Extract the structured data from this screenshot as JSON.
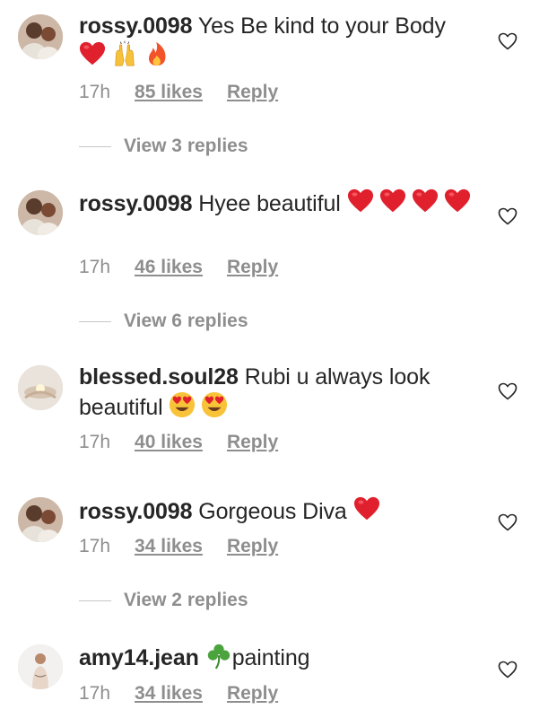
{
  "comments": [
    {
      "username": "rossy.0098",
      "text": "Yes Be kind to your Body",
      "time": "17h",
      "likes": "85 likes",
      "reply": "Reply",
      "view_replies": "View 3 replies"
    },
    {
      "username": "rossy.0098",
      "text": "Hyee beautiful",
      "time": "17h",
      "likes": "46 likes",
      "reply": "Reply",
      "view_replies": "View 6 replies"
    },
    {
      "username": "blessed.soul28",
      "text": "Rubi u always look beautiful",
      "time": "17h",
      "likes": "40 likes",
      "reply": "Reply"
    },
    {
      "username": "rossy.0098",
      "text": "Gorgeous Diva",
      "time": "17h",
      "likes": "34 likes",
      "reply": "Reply",
      "view_replies": "View 2 replies"
    },
    {
      "username": "amy14.jean",
      "text": "painting",
      "time": "17h",
      "likes": "34 likes",
      "reply": "Reply"
    }
  ],
  "colors": {
    "text": "#262626",
    "secondary": "#8e8e8e",
    "heart_emoji": "#e0202d",
    "divider": "#c7c7c7"
  },
  "icons": {
    "like": "heart-outline-icon",
    "emoji_heart": "red-heart-emoji",
    "emoji_raised_hands": "raised-hands-emoji",
    "emoji_fire": "fire-emoji",
    "emoji_heart_eyes": "heart-eyes-emoji",
    "emoji_shamrock": "shamrock-emoji"
  }
}
